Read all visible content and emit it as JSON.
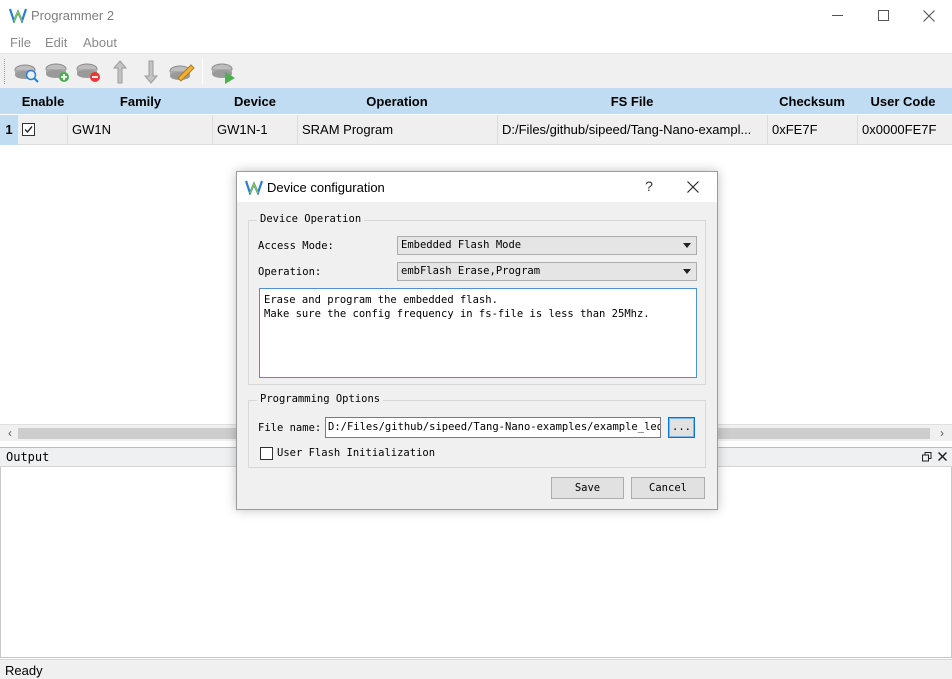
{
  "window": {
    "title": "Programmer 2"
  },
  "menu": {
    "items": [
      "File",
      "Edit",
      "About"
    ]
  },
  "toolbar": {
    "buttons": [
      {
        "icon": "scan-device-icon"
      },
      {
        "icon": "add-device-icon"
      },
      {
        "icon": "remove-device-icon"
      },
      {
        "icon": "move-up-icon"
      },
      {
        "icon": "move-down-icon"
      },
      {
        "icon": "edit-config-icon"
      },
      {
        "icon": "program-run-icon"
      }
    ]
  },
  "table": {
    "columns": [
      "Enable",
      "Family",
      "Device",
      "Operation",
      "FS File",
      "Checksum",
      "User Code"
    ],
    "rows": [
      {
        "num": "1",
        "enabled": true,
        "family": "GW1N",
        "device": "GW1N-1",
        "operation": "SRAM Program",
        "fs_file": "D:/Files/github/sipeed/Tang-Nano-exampl...",
        "checksum": "0xFE7F",
        "user_code": "0x0000FE7F"
      }
    ]
  },
  "output": {
    "title": "Output"
  },
  "status": {
    "text": "Ready"
  },
  "dialog": {
    "title": "Device configuration",
    "help": "?",
    "device_operation": {
      "group_title": "Device Operation",
      "access_mode_label": "Access Mode:",
      "access_mode_value": "Embedded Flash Mode",
      "operation_label": "Operation:",
      "operation_value": "embFlash Erase,Program",
      "description": "Erase and program the embedded flash.\nMake sure the config frequency in fs-file is less than 25Mhz."
    },
    "programming_options": {
      "group_title": "Programming Options",
      "file_name_label": "File name:",
      "file_name_value": "D:/Files/github/sipeed/Tang-Nano-examples/example_led/l",
      "browse_label": "...",
      "user_flash_label": "User Flash Initialization",
      "user_flash_checked": false
    },
    "save_label": "Save",
    "cancel_label": "Cancel"
  }
}
